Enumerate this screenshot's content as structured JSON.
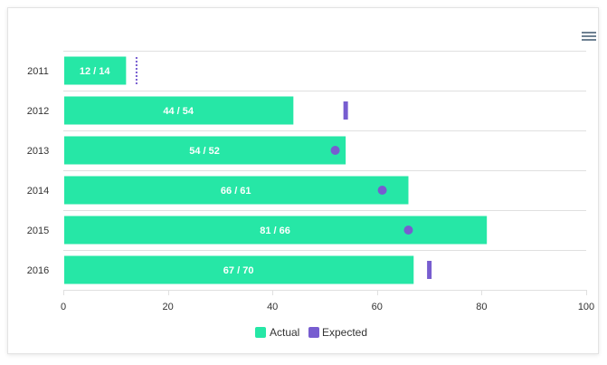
{
  "chart_data": {
    "type": "bar",
    "orientation": "horizontal",
    "categories": [
      "2011",
      "2012",
      "2013",
      "2014",
      "2015",
      "2016"
    ],
    "series": [
      {
        "name": "Actual",
        "values": [
          12,
          44,
          54,
          66,
          81,
          67
        ],
        "color": "#26e7a6"
      },
      {
        "name": "Expected",
        "values": [
          14,
          54,
          52,
          61,
          66,
          70
        ],
        "color": "#775dd0"
      }
    ],
    "markers": [
      "dotted-line",
      "line",
      "circle",
      "circle",
      "circle",
      "line"
    ],
    "data_labels": [
      "12 / 14",
      "44 / 54",
      "54 / 52",
      "66 / 61",
      "81 / 66",
      "67 / 70"
    ],
    "x_ticks": [
      "0",
      "20",
      "40",
      "60",
      "80",
      "100"
    ],
    "xlim": [
      0,
      100
    ],
    "grid": "horizontal",
    "legend_position": "bottom"
  },
  "toolbar": {
    "menu_icon": "hamburger-menu-icon"
  }
}
